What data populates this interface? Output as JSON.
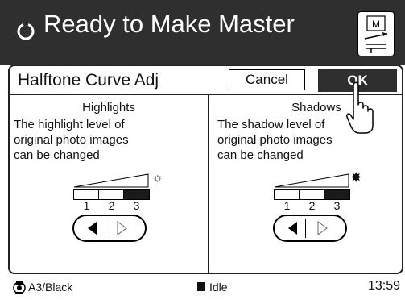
{
  "header": {
    "title": "Ready to Make Master",
    "status_icon": "circle-arrow-icon",
    "master_icon": "master-icon"
  },
  "dialog": {
    "title": "Halftone Curve Adj",
    "cancel_label": "Cancel",
    "ok_label": "OK"
  },
  "highlights": {
    "heading": "Highlights",
    "line1": "The highlight level of",
    "line2": "original photo images",
    "line3": "can be changed",
    "levels": [
      "1",
      "2",
      "3"
    ],
    "selected_level": 3,
    "icon": "sun-outline-icon"
  },
  "shadows": {
    "heading": "Shadows",
    "line1": "The shadow level of",
    "line2": "original photo images",
    "line3": "can be changed",
    "levels": [
      "1",
      "2",
      "3"
    ],
    "selected_level": 3,
    "icon": "sun-filled-icon"
  },
  "status": {
    "paper": "A3/Black",
    "state": "Idle",
    "time": "13:59"
  }
}
